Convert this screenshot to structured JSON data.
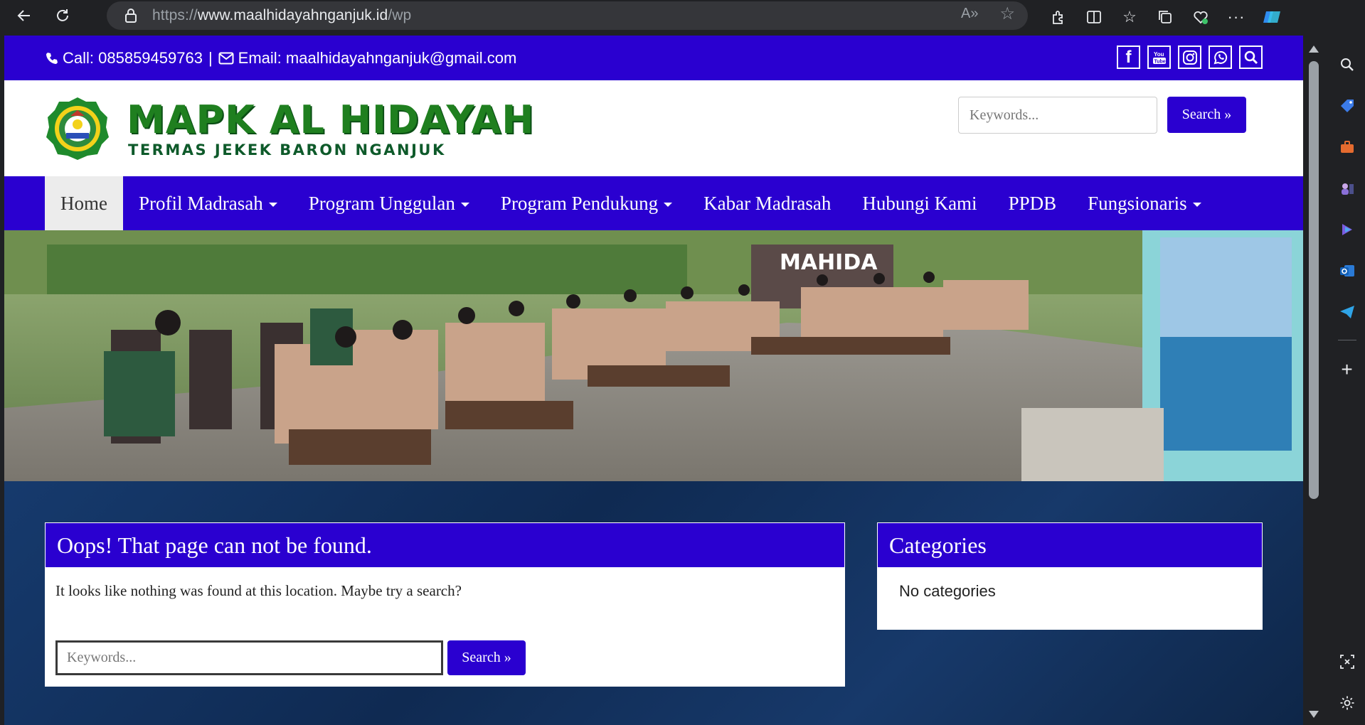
{
  "browser": {
    "url_prefix": "https://",
    "url_domain": "www.maalhidayahnganjuk.id",
    "url_path": "/wp"
  },
  "topbar": {
    "call_text": "Call: 085859459763",
    "separator": "|",
    "email_text": "Email: maalhidayahnganjuk@gmail.com",
    "social_icons": [
      "facebook-icon",
      "youtube-icon",
      "instagram-icon",
      "whatsapp-icon",
      "search-icon"
    ]
  },
  "header": {
    "brand_title": "MAPK AL HIDAYAH",
    "brand_subtitle": "TERMAS JEKEK BARON NGANJUK",
    "search_placeholder": "Keywords...",
    "search_button": "Search »"
  },
  "nav": {
    "items": [
      {
        "label": "Home",
        "dropdown": false,
        "active": true
      },
      {
        "label": "Profil Madrasah",
        "dropdown": true
      },
      {
        "label": "Program Unggulan",
        "dropdown": true
      },
      {
        "label": "Program Pendukung",
        "dropdown": true
      },
      {
        "label": "Kabar Madrasah",
        "dropdown": false
      },
      {
        "label": "Hubungi Kami",
        "dropdown": false
      },
      {
        "label": "PPDB",
        "dropdown": false
      },
      {
        "label": "Fungsionaris",
        "dropdown": true
      }
    ]
  },
  "hero": {
    "sign_text": "MAHIDA"
  },
  "main": {
    "title": "Oops! That page can not be found.",
    "message": "It looks like nothing was found at this location. Maybe try a search?",
    "search_placeholder": "Keywords...",
    "search_button": "Search »"
  },
  "sidebar": {
    "title": "Categories",
    "empty_text": "No categories"
  },
  "colors": {
    "primary": "#2a00d0",
    "brand_green": "#1f7f1f",
    "content_bg": "#14305a"
  }
}
